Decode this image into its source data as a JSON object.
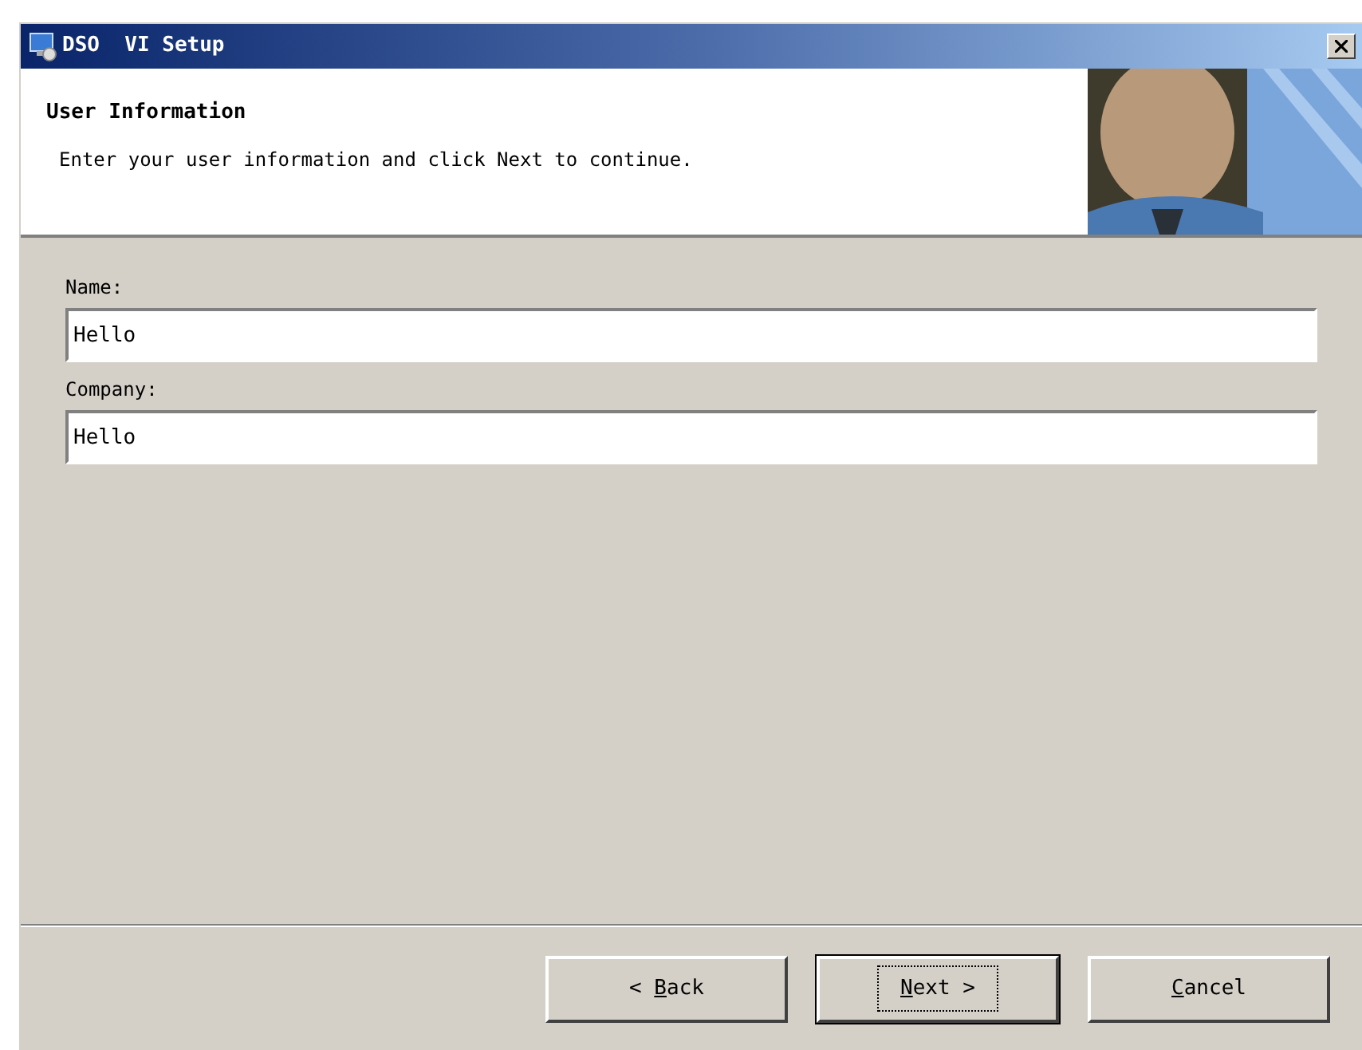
{
  "window": {
    "title": "DSO  VI Setup"
  },
  "header": {
    "title": "User Information",
    "subtitle": "Enter your user information and click Next to continue."
  },
  "fields": [
    {
      "label": "Name:",
      "value": "Hello"
    },
    {
      "label": "Company:",
      "value": "Hello"
    }
  ],
  "buttons": [
    {
      "before": "< ",
      "key": "B",
      "after": "ack",
      "default": false
    },
    {
      "key": "N",
      "after": "ext >",
      "default": true
    },
    {
      "key": "C",
      "after": "ancel",
      "default": false
    }
  ]
}
